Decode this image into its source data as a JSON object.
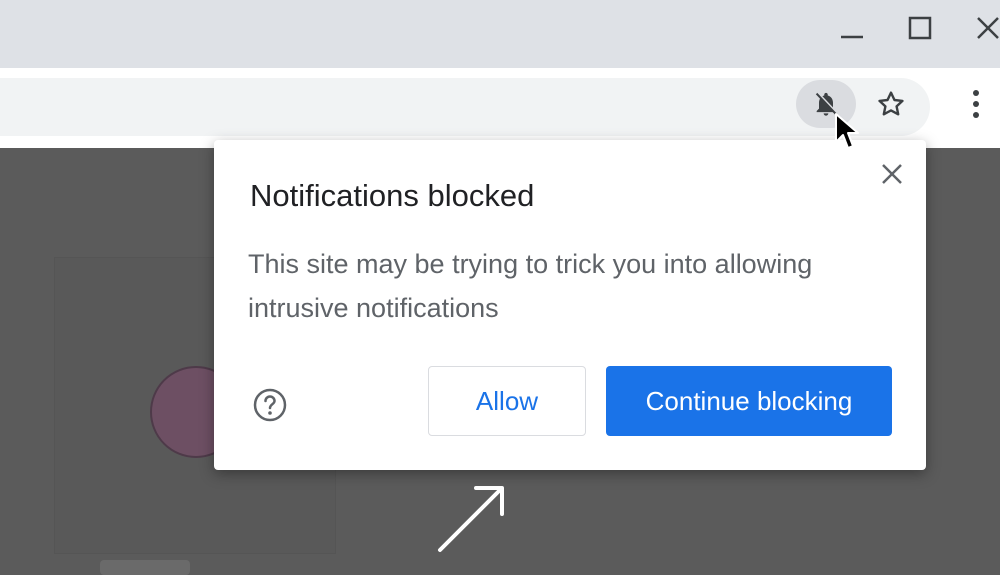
{
  "window": {
    "controls": [
      "minimize-icon",
      "maximize-icon",
      "close-icon"
    ]
  },
  "toolbar": {
    "icons": [
      "notifications-blocked-icon",
      "bookmark-star-icon",
      "more-menu-icon"
    ]
  },
  "popup": {
    "title": "Notifications blocked",
    "message": "This site may be trying to trick you into allowing intrusive notifications",
    "help_icon": "help-icon",
    "close_icon": "close-icon",
    "allow_label": "Allow",
    "continue_label": "Continue blocking"
  },
  "colors": {
    "accent": "#1a73e8",
    "titlebar": "#dee1e6",
    "page_overlay": "#5b5b5b"
  }
}
